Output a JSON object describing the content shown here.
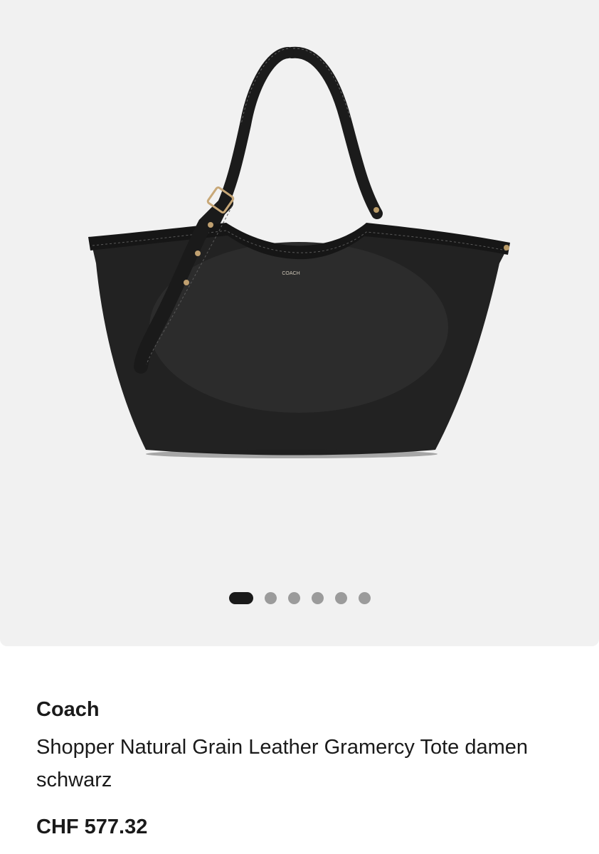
{
  "product": {
    "brand": "Coach",
    "title": "Shopper Natural Grain Leather Gramercy Tote damen schwarz",
    "price": "CHF 577.32",
    "image": {
      "bag_logo_text": "COACH",
      "alt": "Coach black leather tote bag"
    }
  },
  "gallery": {
    "image_count": 6,
    "active_index": 0
  },
  "colors": {
    "gallery_background": "#f1f1f1",
    "bag": "#1f1f1f",
    "active_dot": "#1a1a1a",
    "inactive_dot": "#9b9b9b",
    "text": "#1a1a1a"
  }
}
